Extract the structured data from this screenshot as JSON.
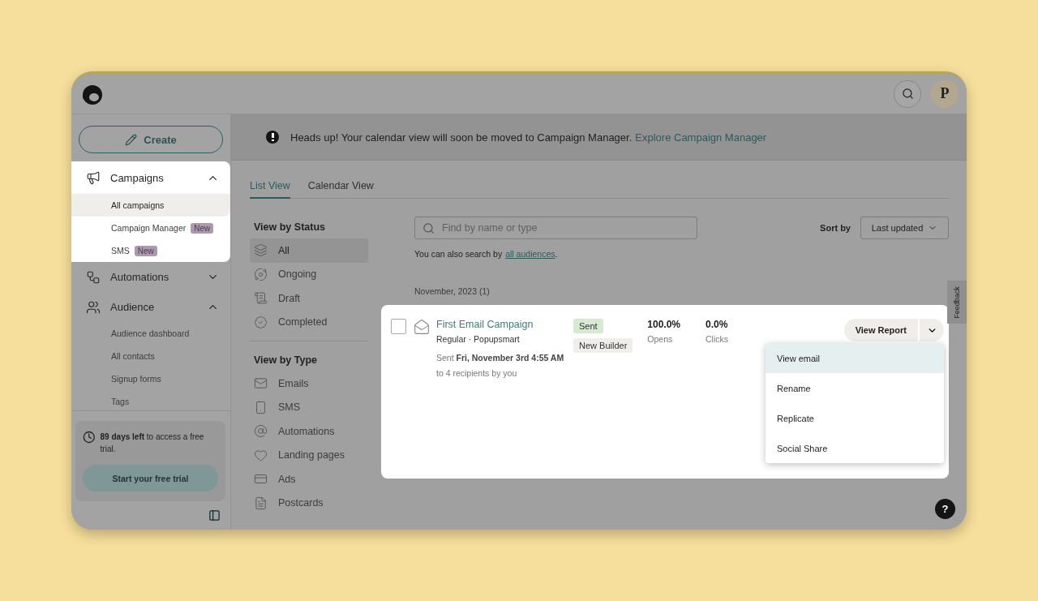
{
  "topbar": {
    "avatar": "P"
  },
  "sidebar": {
    "create": "Create",
    "nav": [
      {
        "kind": "campaigns",
        "label": "Campaigns",
        "expanded": true,
        "highlighted": true,
        "children": [
          {
            "label": "All campaigns",
            "selected": true,
            "highlighted": true
          },
          {
            "label": "Campaign Manager",
            "badge": "New",
            "selected": false,
            "highlighted": false
          },
          {
            "label": "SMS",
            "badge": "New",
            "selected": false,
            "highlighted": false
          }
        ]
      },
      {
        "kind": "automations",
        "label": "Automations",
        "expanded": false,
        "highlighted": false
      },
      {
        "kind": "audience",
        "label": "Audience",
        "expanded": true,
        "highlighted": false,
        "children": [
          {
            "label": "Audience dashboard",
            "selected": false,
            "highlighted": false
          },
          {
            "label": "All contacts",
            "selected": false,
            "highlighted": false
          },
          {
            "label": "Signup forms",
            "selected": false,
            "highlighted": false
          },
          {
            "label": "Tags",
            "selected": false,
            "highlighted": false
          }
        ]
      }
    ],
    "trial": {
      "text": "**89 days left** to access a free trial.",
      "button": "Start your free trial"
    }
  },
  "banner": {
    "text": "Heads up! Your calendar view will soon be moved to Campaign Manager.",
    "link": "Explore Campaign Manager"
  },
  "tabs": [
    {
      "label": "List View",
      "selected": true
    },
    {
      "label": "Calendar View",
      "selected": false
    }
  ],
  "filters": [
    {
      "title": "View by Status",
      "items": [
        {
          "kind": "all",
          "label": "All",
          "selected": true
        },
        {
          "kind": "ongoing",
          "label": "Ongoing",
          "selected": false
        },
        {
          "kind": "draft",
          "label": "Draft",
          "selected": false
        },
        {
          "kind": "completed",
          "label": "Completed",
          "selected": false
        }
      ]
    },
    {
      "title": "View by Type",
      "items": [
        {
          "kind": "emails",
          "label": "Emails",
          "selected": false
        },
        {
          "kind": "sms",
          "label": "SMS",
          "selected": false
        },
        {
          "kind": "automations",
          "label": "Automations",
          "selected": false
        },
        {
          "kind": "landing",
          "label": "Landing pages",
          "selected": false
        },
        {
          "kind": "ads",
          "label": "Ads",
          "selected": false
        },
        {
          "kind": "postcards",
          "label": "Postcards",
          "selected": false
        }
      ]
    }
  ],
  "search": {
    "placeholder": "Find by name or type",
    "hint": "You can also search by",
    "hint_link": "all audiences",
    "hint_end": "."
  },
  "sort": {
    "label": "Sort by",
    "value": "Last updated"
  },
  "group": "November, 2023 (1)",
  "campaign": {
    "highlighted": true,
    "checked": false,
    "name": "First Email Campaign",
    "meta": "Regular · Popupsmart",
    "sent": "Sent **Fri, November 3rd 4:55 AM**",
    "recipients": "to 4 recipients by you",
    "tags": [
      {
        "label": "Sent",
        "color": "#d6ead2"
      },
      {
        "label": "New Builder",
        "color": "#efeeea"
      }
    ],
    "stats": [
      {
        "value": "100.0%",
        "label": "Opens"
      },
      {
        "value": "0.0%",
        "label": "Clicks"
      }
    ],
    "report": "View Report",
    "menu": [
      {
        "label": "View email",
        "selected": true
      },
      {
        "label": "Rename",
        "selected": false
      },
      {
        "label": "Replicate",
        "selected": false
      },
      {
        "label": "Social Share",
        "selected": false
      }
    ]
  },
  "feedback": "Feedback",
  "help": "?"
}
